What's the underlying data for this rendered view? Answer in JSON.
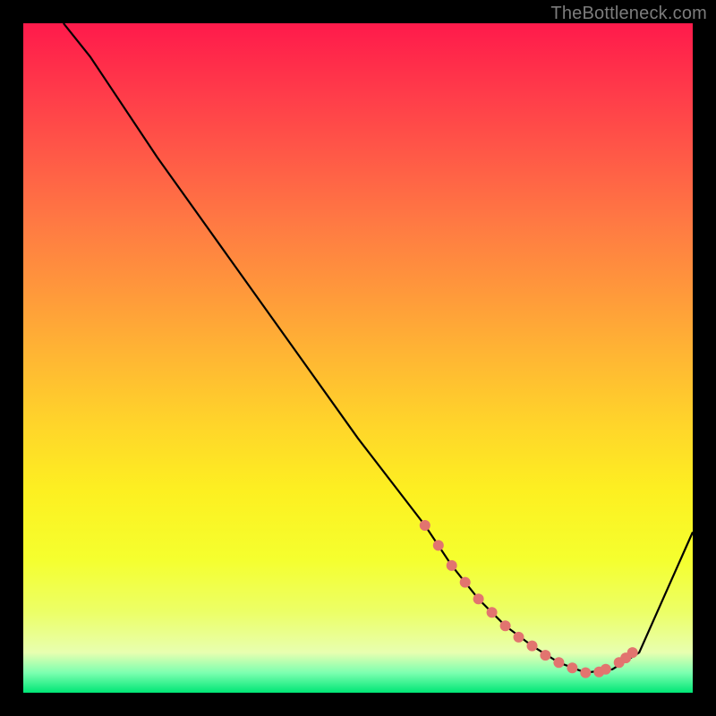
{
  "watermark": "TheBottleneck.com",
  "chart_data": {
    "type": "line",
    "title": "",
    "xlabel": "",
    "ylabel": "",
    "xlim": [
      0,
      100
    ],
    "ylim": [
      0,
      100
    ],
    "grid": false,
    "legend": false,
    "series": [
      {
        "name": "curve",
        "color": "#000000",
        "x": [
          6,
          10,
          20,
          30,
          40,
          50,
          60,
          64,
          68,
          72,
          76,
          80,
          84,
          88,
          92,
          100
        ],
        "y": [
          100,
          95,
          80,
          66,
          52,
          38,
          25,
          19,
          14,
          10,
          7,
          4.5,
          3,
          3.5,
          6,
          24
        ]
      }
    ],
    "highlight": {
      "name": "highlight-band",
      "color": "#e2746f",
      "x": [
        60,
        62,
        64,
        66,
        68,
        70,
        72,
        74,
        76,
        78,
        80,
        82,
        84,
        86,
        87,
        89,
        90,
        91
      ],
      "y": [
        25,
        22,
        19,
        16.5,
        14,
        12,
        10,
        8.3,
        7,
        5.6,
        4.5,
        3.7,
        3,
        3.1,
        3.5,
        4.5,
        5.2,
        6
      ]
    }
  }
}
